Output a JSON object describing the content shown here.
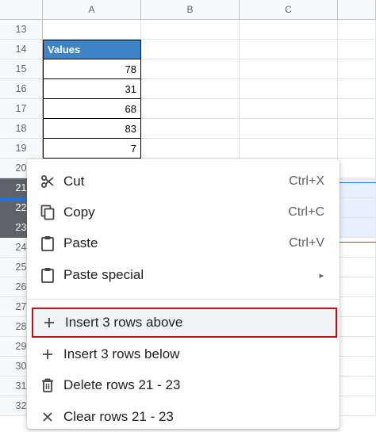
{
  "columns": [
    "A",
    "B",
    "C"
  ],
  "rows": [
    {
      "num": "13",
      "a": ""
    },
    {
      "num": "14",
      "a": "Values"
    },
    {
      "num": "15",
      "a": "78"
    },
    {
      "num": "16",
      "a": "31"
    },
    {
      "num": "17",
      "a": "68"
    },
    {
      "num": "18",
      "a": "83"
    },
    {
      "num": "19",
      "a": "7"
    },
    {
      "num": "20",
      "a": ""
    },
    {
      "num": "21",
      "a": ""
    },
    {
      "num": "22",
      "a": ""
    },
    {
      "num": "23",
      "a": ""
    },
    {
      "num": "24",
      "a": ""
    },
    {
      "num": "25",
      "a": ""
    },
    {
      "num": "26",
      "a": ""
    },
    {
      "num": "27",
      "a": ""
    },
    {
      "num": "28",
      "a": ""
    },
    {
      "num": "29",
      "a": ""
    },
    {
      "num": "30",
      "a": ""
    },
    {
      "num": "31",
      "a": ""
    },
    {
      "num": "32",
      "a": ""
    }
  ],
  "selected_rows": [
    "21",
    "22",
    "23"
  ],
  "colors": {
    "header_fill": "#3d85c6",
    "selection": "#1a73e8",
    "highlight_border": "#d0021b"
  },
  "menu": {
    "items": [
      {
        "label": "Cut",
        "shortcut": "Ctrl+X",
        "icon": "scissors-icon"
      },
      {
        "label": "Copy",
        "shortcut": "Ctrl+C",
        "icon": "copy-icon"
      },
      {
        "label": "Paste",
        "shortcut": "Ctrl+V",
        "icon": "clipboard-icon"
      },
      {
        "label": "Paste special",
        "shortcut": "",
        "icon": "clipboard-icon",
        "submenu": "▸"
      },
      {
        "label": "Insert 3 rows above",
        "shortcut": "",
        "icon": "plus-icon",
        "highlighted": true
      },
      {
        "label": "Insert 3 rows below",
        "shortcut": "",
        "icon": "plus-icon"
      },
      {
        "label": "Delete rows 21 - 23",
        "shortcut": "",
        "icon": "trash-icon"
      },
      {
        "label": "Clear rows 21 - 23",
        "shortcut": "",
        "icon": "close-icon"
      }
    ]
  }
}
